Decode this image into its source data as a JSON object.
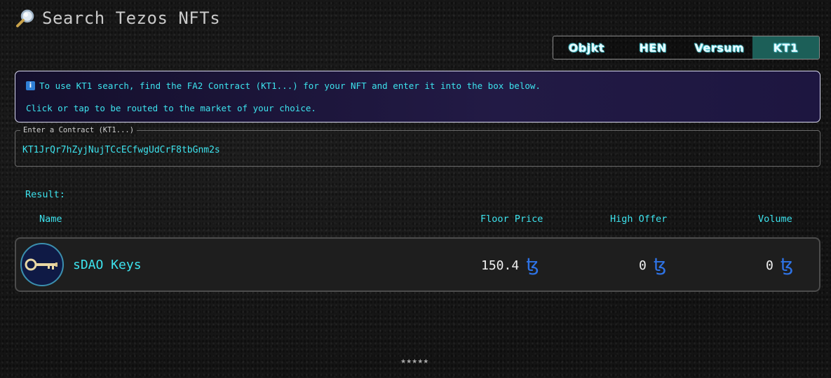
{
  "header": {
    "title": "Search Tezos NFTs",
    "icon": "magnifier-icon"
  },
  "tabs": [
    {
      "label": "Objkt",
      "active": false
    },
    {
      "label": "HEN",
      "active": false
    },
    {
      "label": "Versum",
      "active": false
    },
    {
      "label": "KT1",
      "active": true
    }
  ],
  "info": {
    "icon": "info-icon",
    "line1": "To use KT1 search, find the FA2 Contract (KT1...) for your NFT and enter it into the box below.",
    "line2": "Click or tap to be routed to the market of your choice."
  },
  "contract_field": {
    "label": "Enter a Contract (KT1...)",
    "value": "KT1JrQr7hZyjNujTCcECfwgUdCrF8tbGnm2s"
  },
  "results": {
    "label": "Result:",
    "columns": {
      "name": "Name",
      "floor": "Floor Price",
      "offer": "High Offer",
      "volume": "Volume"
    },
    "rows": [
      {
        "name": "sDAO Keys",
        "floor": "150.4",
        "offer": "0",
        "volume": "0",
        "currency_symbol": "ꜩ",
        "avatar": "key-icon"
      }
    ]
  },
  "footer": {
    "stars": "★★★★★"
  },
  "colors": {
    "accent": "#3de3ee",
    "tez": "#2e73e6",
    "active_tab": "#1c5f58"
  }
}
